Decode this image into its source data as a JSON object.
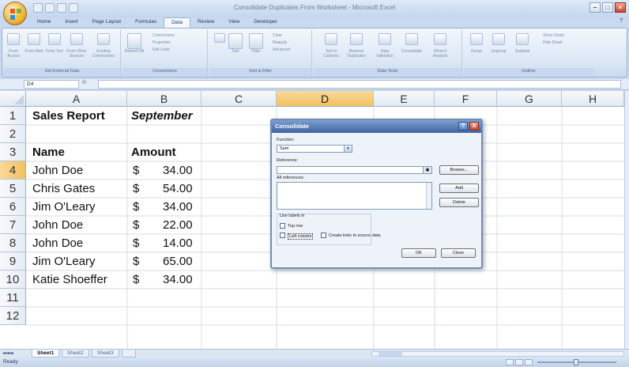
{
  "window": {
    "title": "Consolidate Duplicates From Worksheet - Microsoft Excel"
  },
  "ribbon": {
    "tabs": [
      "Home",
      "Insert",
      "Page Layout",
      "Formulas",
      "Data",
      "Review",
      "View",
      "Developer"
    ],
    "active_tab": "Data",
    "groups": {
      "get_external_data": {
        "label": "Get External Data",
        "buttons": [
          "From Access",
          "From Web",
          "From Text",
          "From Other Sources",
          "Existing Connections"
        ]
      },
      "connections": {
        "label": "Connections",
        "refresh": "Refresh All",
        "items": [
          "Connections",
          "Properties",
          "Edit Links"
        ]
      },
      "sort_filter": {
        "label": "Sort & Filter",
        "sort": "Sort",
        "filter": "Filter",
        "items": [
          "Clear",
          "Reapply",
          "Advanced"
        ]
      },
      "data_tools": {
        "label": "Data Tools",
        "buttons": [
          "Text to Columns",
          "Remove Duplicates",
          "Data Validation",
          "Consolidate",
          "What-If Analysis"
        ]
      },
      "outline": {
        "label": "Outline",
        "buttons": [
          "Group",
          "Ungroup",
          "Subtotal"
        ],
        "items": [
          "Show Detail",
          "Hide Detail"
        ]
      }
    }
  },
  "formula_bar": {
    "name_box": "D4",
    "fx": "fx",
    "formula": ""
  },
  "sheet": {
    "columns": [
      "A",
      "B",
      "C",
      "D",
      "E",
      "F",
      "G",
      "H"
    ],
    "selected_column": "D",
    "rows": [
      "1",
      "2",
      "3",
      "4",
      "5",
      "6",
      "7",
      "8",
      "9",
      "10",
      "11",
      "12"
    ],
    "selected_row": "4",
    "cells": {
      "a1": "Sales Report",
      "b1": "September",
      "a3": "Name",
      "b3": "Amount",
      "names": [
        "John Doe",
        "Chris Gates",
        "Jim O'Leary",
        "John Doe",
        "John Doe",
        "Jim O'Leary",
        "Katie Shoeffer"
      ],
      "currency": "$",
      "amounts": [
        "34.00",
        "54.00",
        "34.00",
        "22.00",
        "14.00",
        "65.00",
        "34.00"
      ]
    },
    "tabs": [
      "Sheet1",
      "Sheet2",
      "Sheet3"
    ],
    "active_tab": "Sheet1"
  },
  "status": {
    "text": "Ready"
  },
  "dialog": {
    "title": "Consolidate",
    "help": "?",
    "close": "X",
    "function_label": "Function:",
    "function_value": "Sum",
    "reference_label": "Reference:",
    "reference_value": "",
    "all_references_label": "All references:",
    "browse": "Browse...",
    "add": "Add",
    "delete": "Delete",
    "use_labels": "Use labels in",
    "top_row": "Top row",
    "left_column": "Left column",
    "create_links": "Create links to source data",
    "ok": "OK",
    "cancel": "Close"
  }
}
